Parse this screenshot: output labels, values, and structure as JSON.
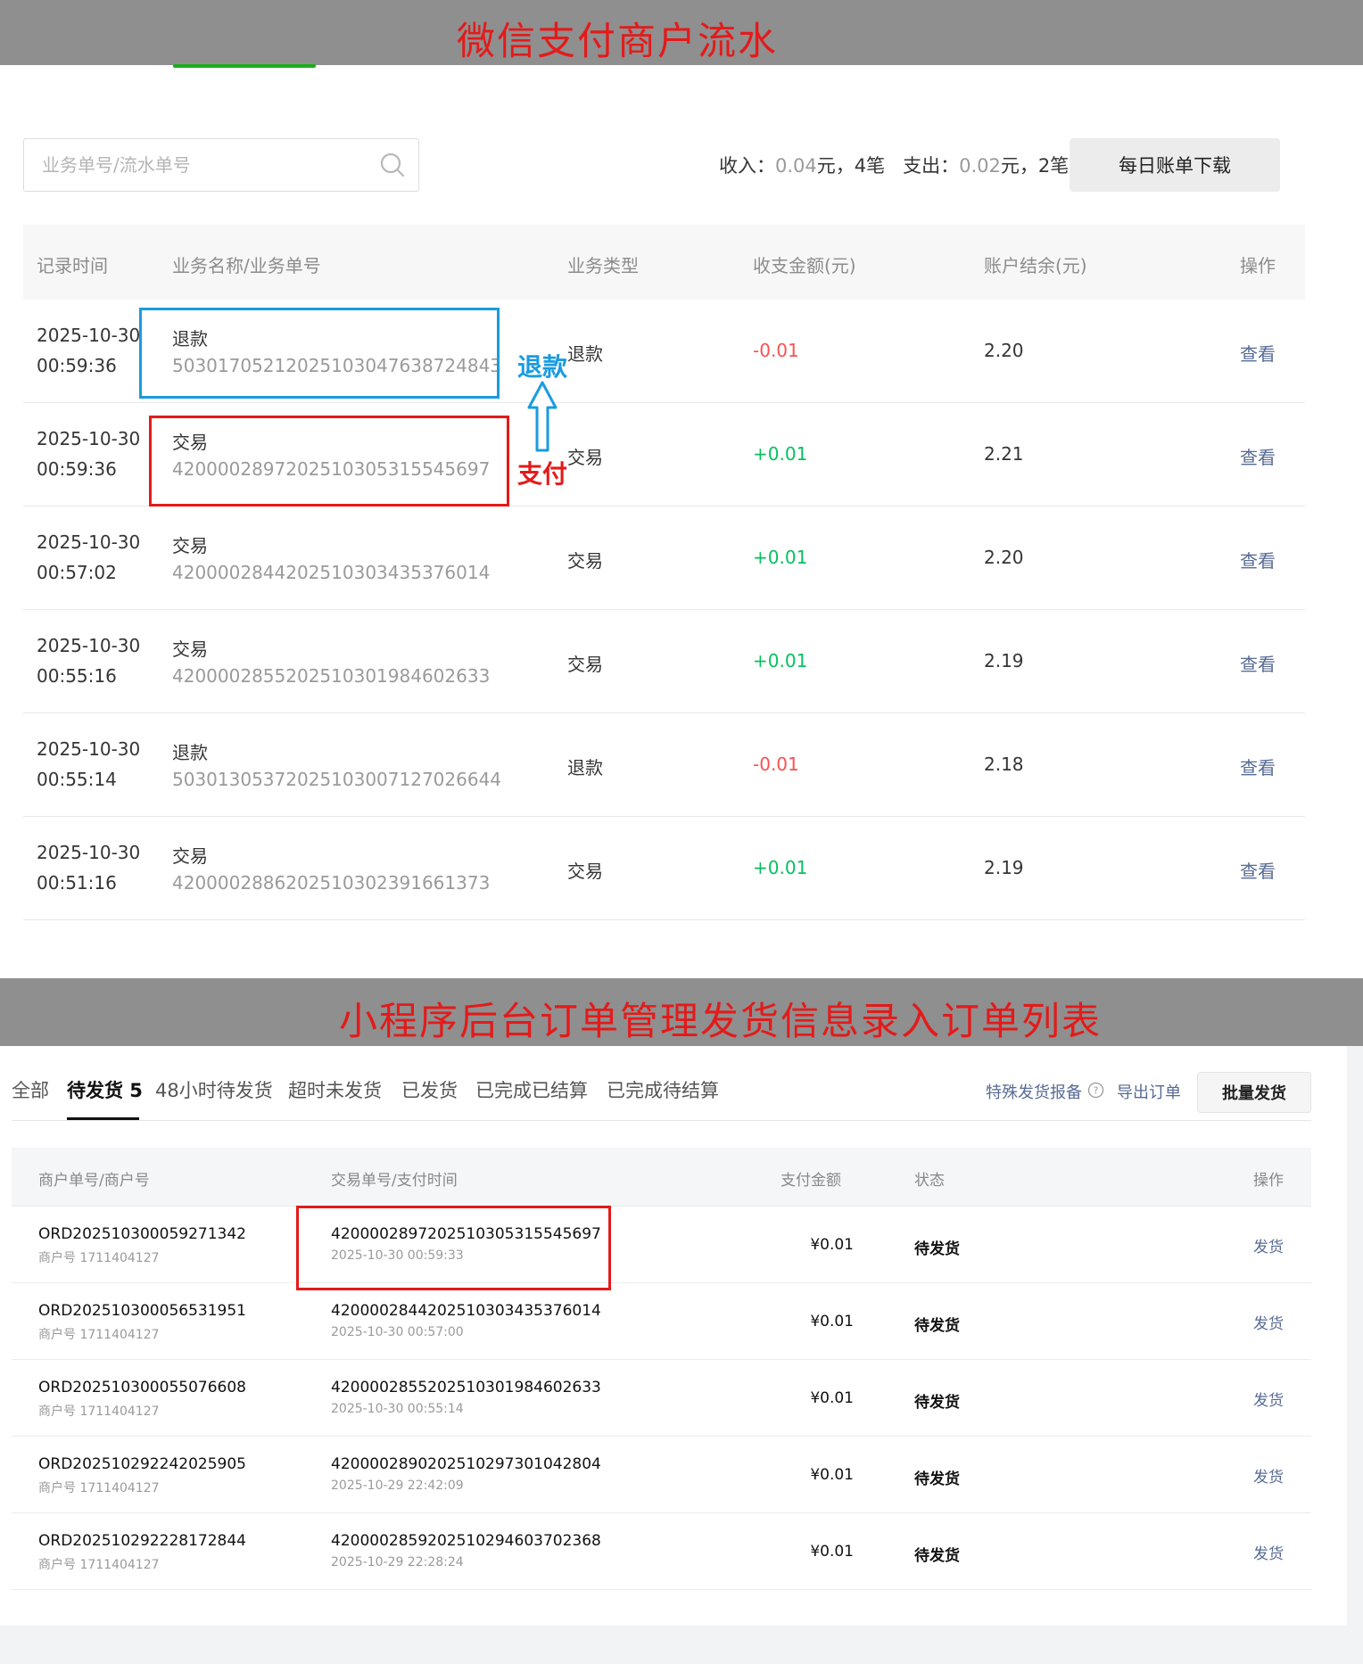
{
  "banners": {
    "top_title": "微信支付商户流水",
    "bottom_title": "小程序后台订单管理发货信息录入订单列表"
  },
  "flow": {
    "search_placeholder": "业务单号/流水单号",
    "summary": {
      "income_label": "收入：",
      "income_amount": "0.04",
      "income_suffix": "元，4笔",
      "expense_label": "支出：",
      "expense_amount": "0.02",
      "expense_suffix": "元，2笔"
    },
    "download_label": "每日账单下载",
    "columns": [
      "记录时间",
      "业务名称/业务单号",
      "业务类型",
      "收支金额(元)",
      "账户结余(元)",
      "操作"
    ],
    "rows": [
      {
        "date": "2025-10-30",
        "time": "00:59:36",
        "name": "退款",
        "no": "50301705212025103047638724843",
        "type": "退款",
        "amount": "-0.01",
        "balance": "2.20",
        "action": "查看"
      },
      {
        "date": "2025-10-30",
        "time": "00:59:36",
        "name": "交易",
        "no": "4200002897202510305315545697",
        "type": "交易",
        "amount": "+0.01",
        "balance": "2.21",
        "action": "查看"
      },
      {
        "date": "2025-10-30",
        "time": "00:57:02",
        "name": "交易",
        "no": "4200002844202510303435376014",
        "type": "交易",
        "amount": "+0.01",
        "balance": "2.20",
        "action": "查看"
      },
      {
        "date": "2025-10-30",
        "time": "00:55:16",
        "name": "交易",
        "no": "4200002855202510301984602633",
        "type": "交易",
        "amount": "+0.01",
        "balance": "2.19",
        "action": "查看"
      },
      {
        "date": "2025-10-30",
        "time": "00:55:14",
        "name": "退款",
        "no": "50301305372025103007127026644",
        "type": "退款",
        "amount": "-0.01",
        "balance": "2.18",
        "action": "查看"
      },
      {
        "date": "2025-10-30",
        "time": "00:51:16",
        "name": "交易",
        "no": "4200002886202510302391661373",
        "type": "交易",
        "amount": "+0.01",
        "balance": "2.19",
        "action": "查看"
      }
    ],
    "annotations": {
      "refund": "退款",
      "pay": "支付"
    },
    "colors": {
      "negative": "#fa5151",
      "positive": "#07c160",
      "link": "#576b95",
      "annotation_blue": "#1a9be0",
      "annotation_red": "#e41a1a"
    }
  },
  "orders": {
    "tabs": [
      "全部",
      "待发货 5",
      "48小时待发货",
      "超时未发货",
      "已发货",
      "已完成已结算",
      "已完成待结算"
    ],
    "active_tab": "待发货 5",
    "special_report_label": "特殊发货报备",
    "export_label": "导出订单",
    "batch_ship_label": "批量发货",
    "columns": [
      "商户单号/商户号",
      "交易单号/支付时间",
      "支付金额",
      "状态",
      "操作"
    ],
    "rows": [
      {
        "order_no": "ORD202510300059271342",
        "merchant": "商户号 1711404127",
        "txn_no": "4200002897202510305315545697",
        "pay_time": "2025-10-30 00:59:33",
        "amount": "¥0.01",
        "status": "待发货",
        "action": "发货"
      },
      {
        "order_no": "ORD202510300056531951",
        "merchant": "商户号 1711404127",
        "txn_no": "4200002844202510303435376014",
        "pay_time": "2025-10-30 00:57:00",
        "amount": "¥0.01",
        "status": "待发货",
        "action": "发货"
      },
      {
        "order_no": "ORD202510300055076608",
        "merchant": "商户号 1711404127",
        "txn_no": "4200002855202510301984602633",
        "pay_time": "2025-10-30 00:55:14",
        "amount": "¥0.01",
        "status": "待发货",
        "action": "发货"
      },
      {
        "order_no": "ORD202510292242025905",
        "merchant": "商户号 1711404127",
        "txn_no": "4200002890202510297301042804",
        "pay_time": "2025-10-29 22:42:09",
        "amount": "¥0.01",
        "status": "待发货",
        "action": "发货"
      },
      {
        "order_no": "ORD202510292228172844",
        "merchant": "商户号 1711404127",
        "txn_no": "4200002859202510294603702368",
        "pay_time": "2025-10-29 22:28:24",
        "amount": "¥0.01",
        "status": "待发货",
        "action": "发货"
      }
    ]
  }
}
